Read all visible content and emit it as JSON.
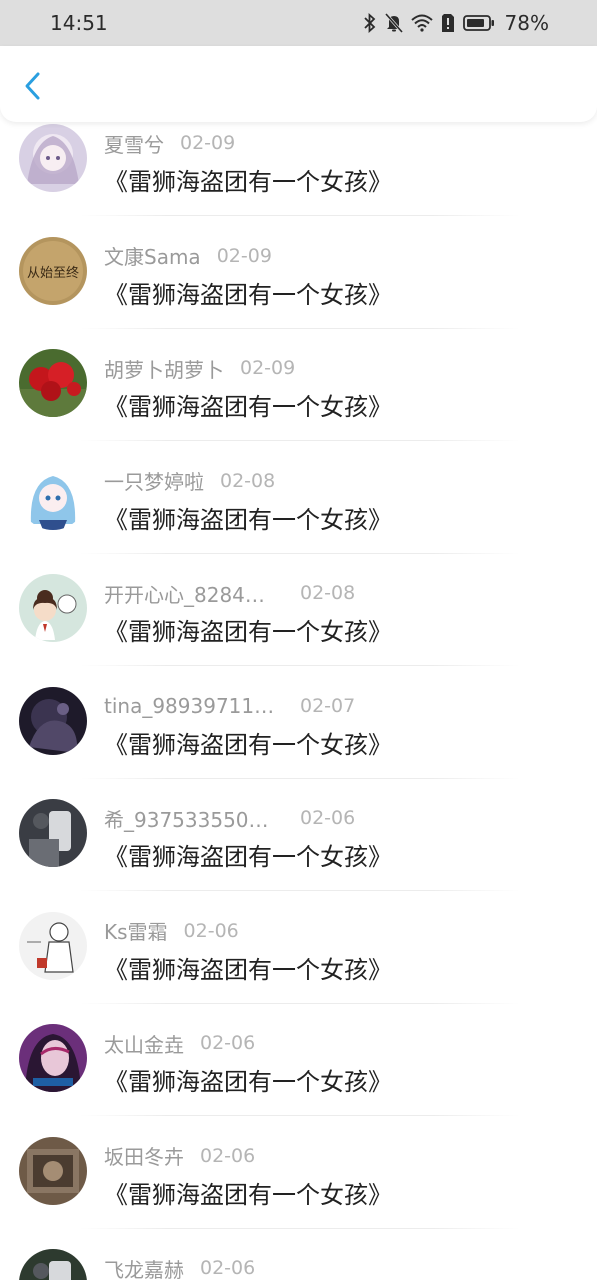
{
  "status_bar": {
    "time": "14:51",
    "battery": "78%"
  },
  "header": {
    "back_icon": "chevron-left-icon"
  },
  "notices": [
    {
      "user": "夏雪兮",
      "date": "02-09",
      "title": "《雷狮海盗团有一个女孩》",
      "avatar_icon": "anime-girl-avatar",
      "avatar_color": "#b9a8c8"
    },
    {
      "user": "文康Sama",
      "date": "02-09",
      "title": "《雷狮海盗团有一个女孩》",
      "avatar_icon": "text-badge-avatar",
      "avatar_color": "#b4955e",
      "avatar_text": "从始至终"
    },
    {
      "user": "胡萝卜胡萝卜",
      "date": "02-09",
      "title": "《雷狮海盗团有一个女孩》",
      "avatar_icon": "red-roses-avatar",
      "avatar_color": "#4a6b2f"
    },
    {
      "user": "一只梦婷啦",
      "date": "02-08",
      "title": "《雷狮海盗团有一个女孩》",
      "avatar_icon": "blue-hair-girl-avatar",
      "avatar_color": "#8fc6ea"
    },
    {
      "user": "开开心心_8284…",
      "date": "02-08",
      "title": "《雷狮海盗团有一个女孩》",
      "avatar_icon": "cartoon-girl-avatar",
      "avatar_color": "#d5e6de"
    },
    {
      "user": "tina_98939711…",
      "date": "02-07",
      "title": "《雷狮海盗团有一个女孩》",
      "avatar_icon": "dark-figure-avatar",
      "avatar_color": "#1e1a2a"
    },
    {
      "user": "希_937533550…",
      "date": "02-06",
      "title": "《雷狮海盗团有一个女孩》",
      "avatar_icon": "dark-photo-avatar",
      "avatar_color": "#3a3d44"
    },
    {
      "user": "Ks雷霜",
      "date": "02-06",
      "title": "《雷狮海盗团有一个女孩》",
      "avatar_icon": "sketch-character-avatar",
      "avatar_color": "#f2f2f2"
    },
    {
      "user": "太山金垚",
      "date": "02-06",
      "title": "《雷狮海盗团有一个女孩》",
      "avatar_icon": "purple-girl-avatar",
      "avatar_color": "#6b2f7a"
    },
    {
      "user": "坂田冬卉",
      "date": "02-06",
      "title": "《雷狮海盗团有一个女孩》",
      "avatar_icon": "brown-photo-avatar",
      "avatar_color": "#6e5a47"
    },
    {
      "user": "飞龙嘉赫",
      "date": "02-06",
      "title": "",
      "avatar_icon": "dark-photo-avatar",
      "avatar_color": "#2d3a2f"
    }
  ],
  "colors": {
    "status_bar_bg": "#dedede",
    "accent": "#2a9fe0",
    "username": "#9a9a9a",
    "date": "#b5b5b5",
    "title": "#222222"
  }
}
